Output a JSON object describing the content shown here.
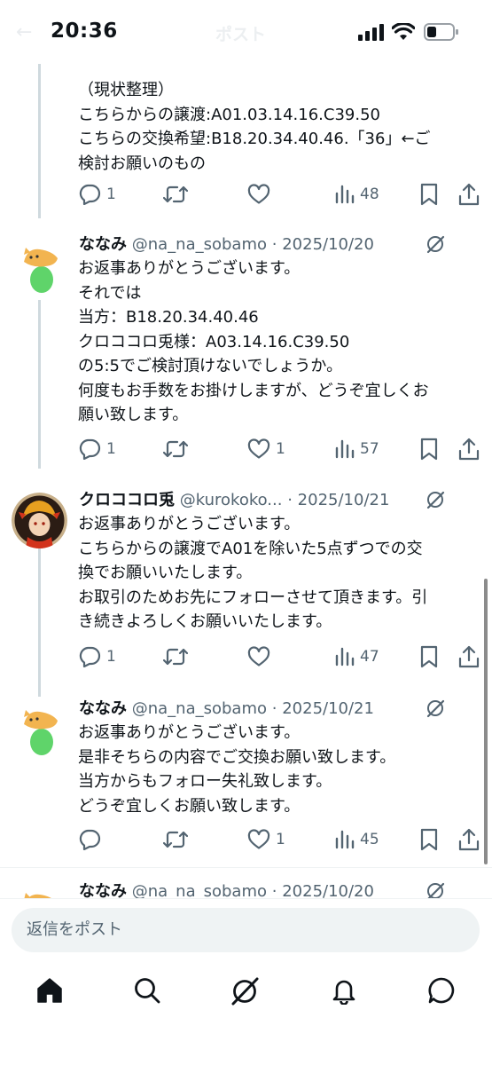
{
  "status_bar": {
    "time": "20:36",
    "back_glyph": "←",
    "faded_title": "ポスト"
  },
  "tweets": [
    {
      "text": "（現状整理）\nこちらからの譲渡:A01.03.14.16.C39.50\nこちらの交換希望:B18.20.34.40.46.「36」←ご\n検討お願いのもの",
      "replies": "1",
      "reposts": "",
      "likes": "",
      "views": "48"
    },
    {
      "name": "ななみ",
      "handle": "@na_na_sobamo",
      "date": "2025/10/20",
      "text": "お返事ありがとうございます。\nそれでは\n当方：B18.20.34.40.46\nクロココロ兎様：A03.14.16.C39.50\nの5:5でご検討頂けないでしょうか。\n何度もお手数をお掛けしますが、どうぞ宜しくお\n願い致します。",
      "replies": "1",
      "reposts": "",
      "likes": "1",
      "views": "57"
    },
    {
      "name": "クロココロ兎",
      "handle": "@kurokoko...",
      "date": "2025/10/21",
      "text": "お返事ありがとうございます。\nこちらからの譲渡でA01を除いた5点ずつでの交\n換でお願いいたします。\nお取引のためお先にフォローさせて頂きます。引\nき続きよろしくお願いいたします。",
      "replies": "1",
      "reposts": "",
      "likes": "",
      "views": "47"
    },
    {
      "name": "ななみ",
      "handle": "@na_na_sobamo",
      "date": "2025/10/21",
      "text": "お返事ありがとうございます。\n是非そちらの内容でご交換お願い致します。\n当方からもフォロー失礼致します。\nどうぞ宜しくお願い致します。",
      "replies": "",
      "reposts": "",
      "likes": "1",
      "views": "45"
    },
    {
      "name": "ななみ",
      "handle": "@na_na_sobamo",
      "date": "2025/10/20"
    }
  ],
  "separator": "·",
  "reply_box": {
    "placeholder": "返信をポスト"
  },
  "bottom_nav": [
    "home-icon",
    "search-icon",
    "grok-icon",
    "notifications-icon",
    "messages-icon"
  ],
  "colors": {
    "text": "#0f1419",
    "secondary": "#536471",
    "thread_line": "#cfd9de",
    "reply_bg": "#eff3f4"
  }
}
